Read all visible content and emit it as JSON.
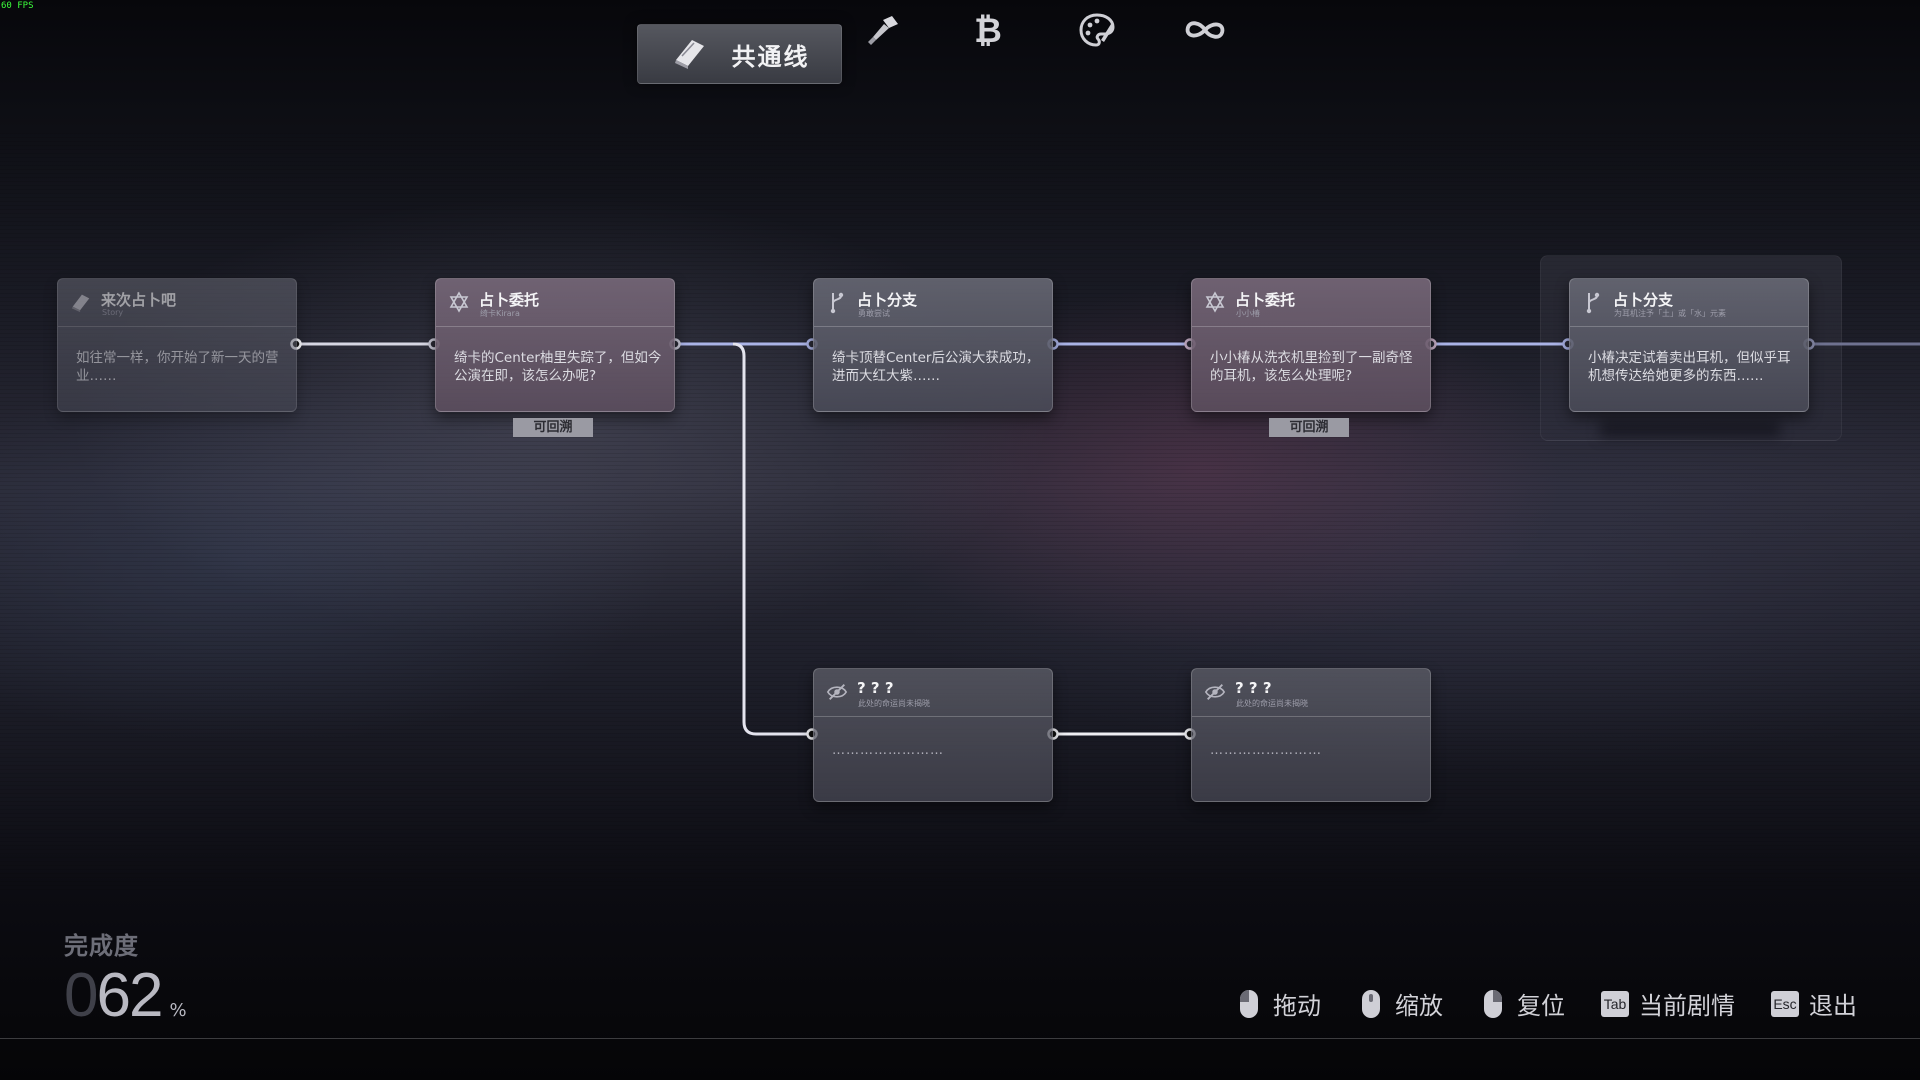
{
  "fps": "60 FPS",
  "tabs": [
    {
      "label": "共通线",
      "icon": "book-icon",
      "active": true
    },
    {
      "label": "",
      "icon": "microphone-icon",
      "active": false
    },
    {
      "label": "",
      "icon": "bitcoin-icon",
      "active": false
    },
    {
      "label": "",
      "icon": "palette-icon",
      "active": false
    },
    {
      "label": "",
      "icon": "infinity-icon",
      "active": false
    }
  ],
  "nodes": [
    {
      "id": "n1",
      "icon": "book-icon",
      "title": "来次占卜吧",
      "subtitle": "Story",
      "text": "如往常一样，你开始了新一天的营业……"
    },
    {
      "id": "n2",
      "icon": "hexagram-icon",
      "title": "占卜委托",
      "subtitle": "绮卡Kirara",
      "text": "绮卡的Center柚里失踪了，但如今公演在即，该怎么办呢?",
      "tag": "可回溯"
    },
    {
      "id": "n3",
      "icon": "branch-icon",
      "title": "占卜分支",
      "subtitle": "勇敢尝试",
      "text": "绮卡顶替Center后公演大获成功，进而大红大紫……"
    },
    {
      "id": "n4",
      "icon": "hexagram-icon",
      "title": "占卜委托",
      "subtitle": "小小椿",
      "text": "小小椿从洗衣机里捡到了一副奇怪的耳机，该怎么处理呢?",
      "tag": "可回溯"
    },
    {
      "id": "n5",
      "icon": "branch-icon",
      "title": "占卜分支",
      "subtitle": "为耳机注予「土」或「水」元素",
      "text": "小椿决定试着卖出耳机，但似乎耳机想传达给她更多的东西……"
    },
    {
      "id": "n6",
      "icon": "eye-off-icon",
      "title": "? ? ?",
      "subtitle": "此处的命运尚未揭晓",
      "text": "……………………"
    },
    {
      "id": "n7",
      "icon": "eye-off-icon",
      "title": "? ? ?",
      "subtitle": "此处的命运尚未揭晓",
      "text": "……………………"
    }
  ],
  "completion": {
    "label": "完成度",
    "dim_digit": "0",
    "value": "62",
    "unit": "%"
  },
  "controls": [
    {
      "icon": "mouse-left-icon",
      "label": "拖动"
    },
    {
      "icon": "mouse-wheel-icon",
      "label": "缩放"
    },
    {
      "icon": "mouse-right-icon",
      "label": "复位"
    },
    {
      "icon": "tab-key-icon",
      "key": "Tab",
      "label": "当前剧情"
    },
    {
      "icon": "esc-key-icon",
      "key": "Esc",
      "label": "退出"
    }
  ]
}
